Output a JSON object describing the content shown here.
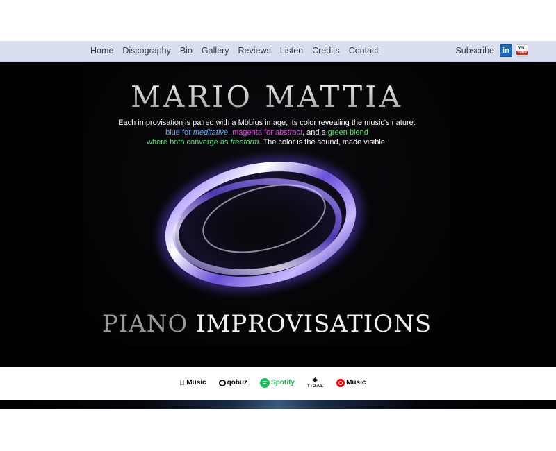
{
  "nav": {
    "items": [
      {
        "label": "Home"
      },
      {
        "label": "Discography"
      },
      {
        "label": "Bio"
      },
      {
        "label": "Gallery"
      },
      {
        "label": "Reviews"
      },
      {
        "label": "Listen"
      },
      {
        "label": "Credits"
      },
      {
        "label": "Contact"
      }
    ],
    "subscribe_label": "Subscribe",
    "linkedin_icon": "linkedin-icon",
    "linkedin_text": "in",
    "youtube_icon": "youtube-icon",
    "youtube_you": "You",
    "youtube_tube": "Tube"
  },
  "hero": {
    "artist_name": "MARIO MATTIA",
    "tagline": {
      "line1": "Each improvisation is paired with a Möbius image, its color revealing the music's nature:",
      "blue_for": "blue for ",
      "meditative": "meditative",
      "comma1": ", ",
      "magenta_for": "magenta for ",
      "abstract": "abstract",
      "and_a": ", and a ",
      "green_blend": "green blend",
      "where_both": "where both converge as ",
      "freeform": "freeform",
      "ending": ". The color is the sound, made visible."
    },
    "album_title_part1": "PIANO",
    "album_title_part2": "IMPROVISATIONS",
    "colors": {
      "meditative": "#5ea8ff",
      "abstract": "#e048e0",
      "freeform": "#5ee07a"
    }
  },
  "streaming": {
    "apple_music": "Music",
    "qobuz": "qobuz",
    "spotify": "Spotify",
    "tidal": "TIDAL",
    "youtube_music": "Music"
  }
}
